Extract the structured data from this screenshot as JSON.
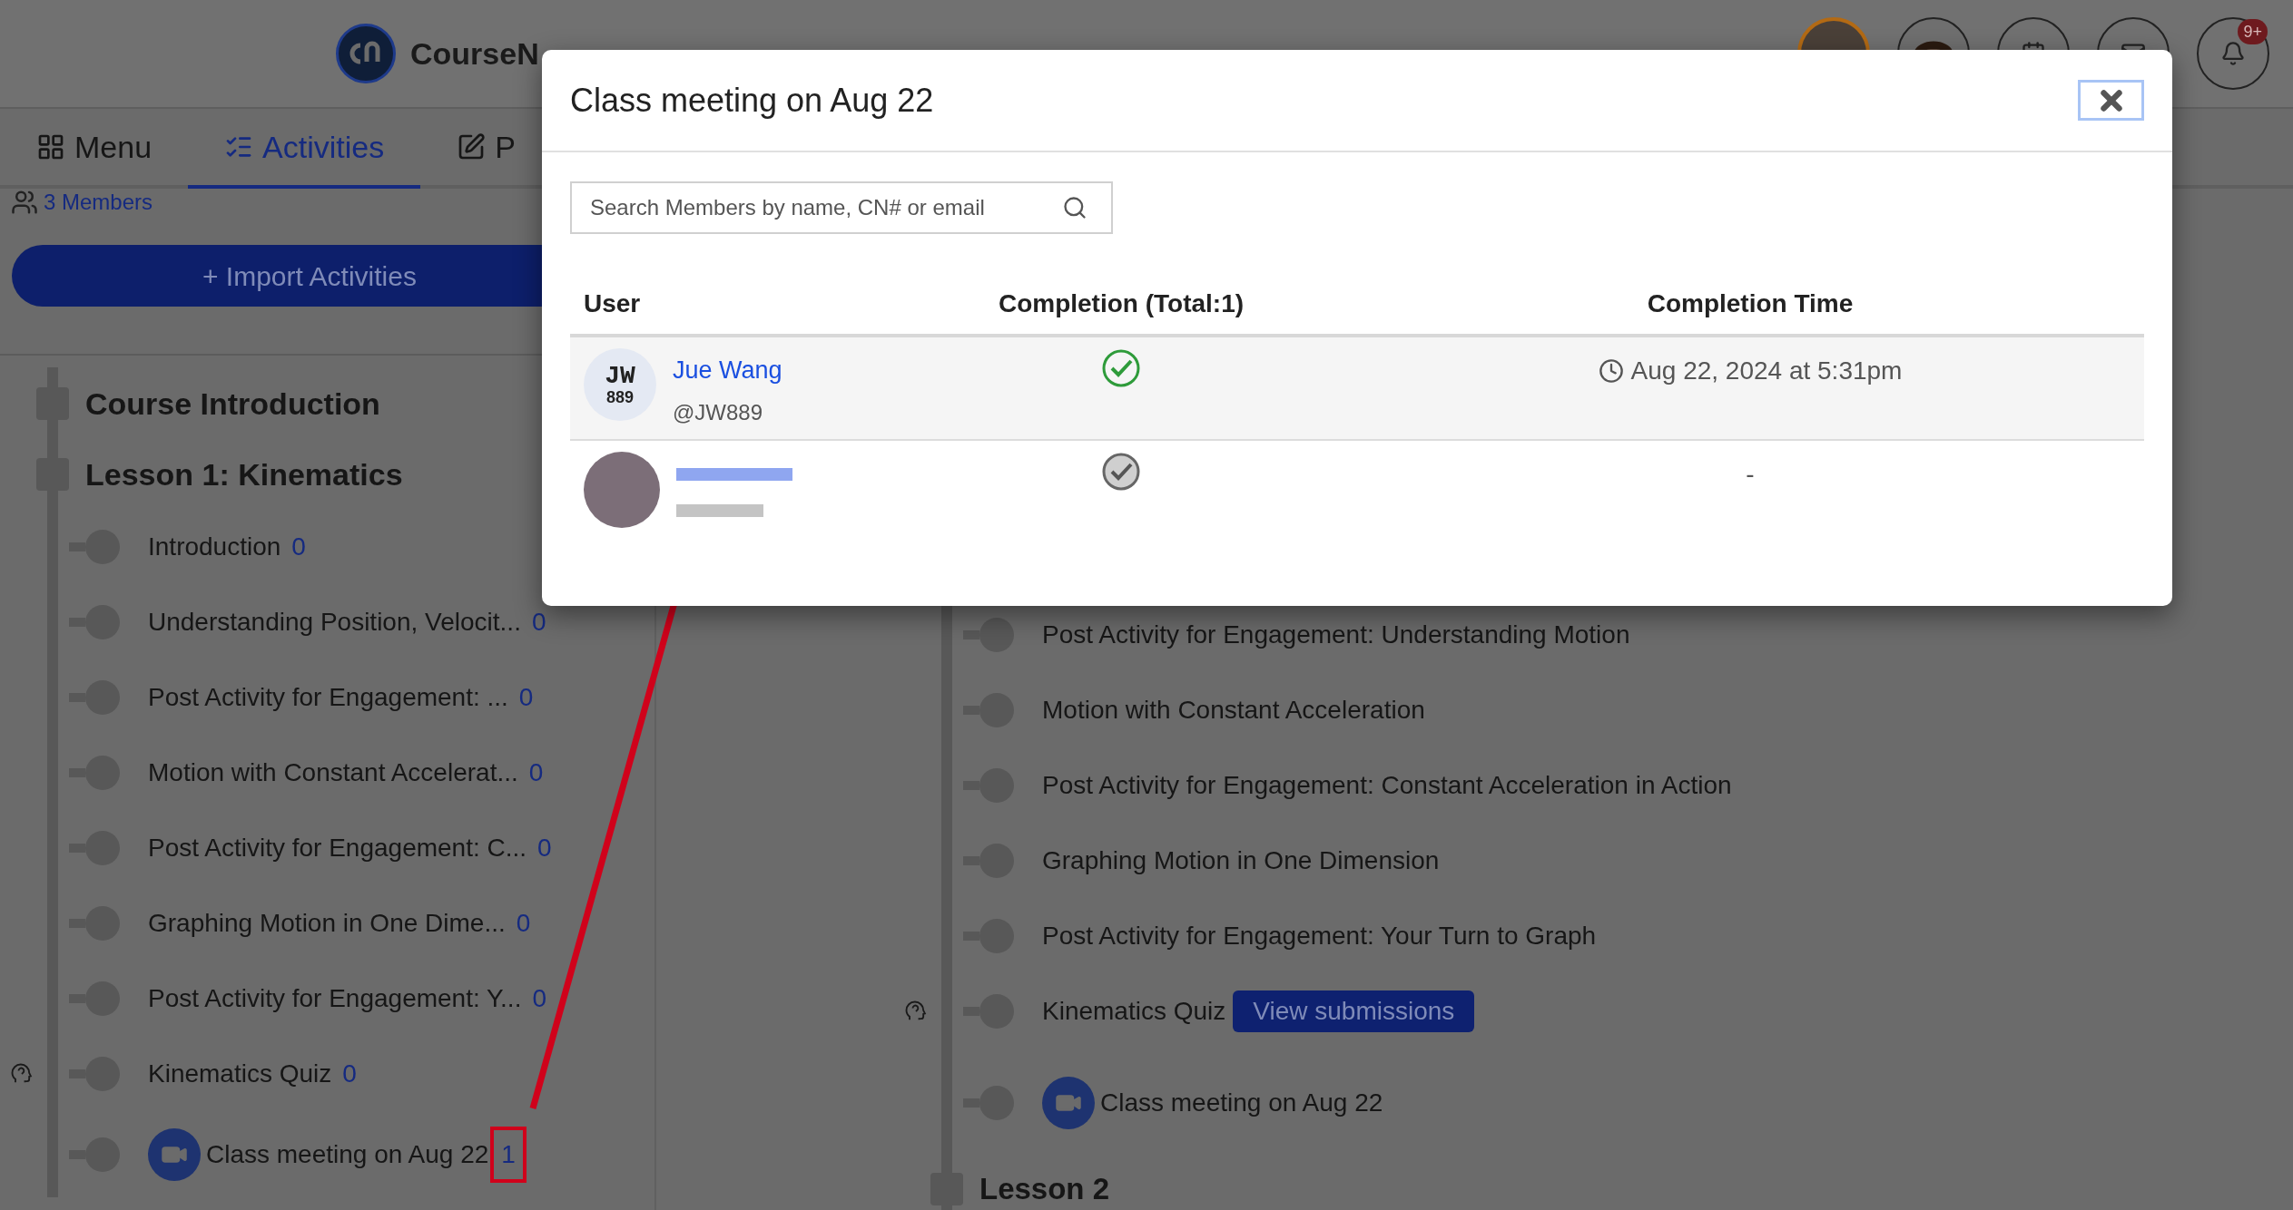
{
  "header": {
    "logo_text": "CourseN",
    "notification_badge": "9+"
  },
  "tabs": [
    {
      "label": "Menu",
      "selected": false
    },
    {
      "label": "Activities",
      "selected": true
    },
    {
      "label": "P",
      "selected": false
    }
  ],
  "members_link": "3 Members",
  "import_button": "+ Import Activities",
  "left_tree": [
    {
      "kind": "section",
      "title": "Course Introduction"
    },
    {
      "kind": "section",
      "title": "Lesson 1: Kinematics"
    },
    {
      "kind": "activity",
      "title": "Introduction",
      "count": "0"
    },
    {
      "kind": "activity",
      "title": "Understanding Position, Velocit...",
      "count": "0"
    },
    {
      "kind": "activity",
      "title": "Post Activity for Engagement: ...",
      "count": "0"
    },
    {
      "kind": "activity",
      "title": "Motion with Constant Accelerat...",
      "count": "0"
    },
    {
      "kind": "activity",
      "title": "Post Activity for Engagement: C...",
      "count": "0"
    },
    {
      "kind": "activity",
      "title": "Graphing Motion in One Dime...",
      "count": "0"
    },
    {
      "kind": "activity",
      "title": "Post Activity for Engagement: Y...",
      "count": "0"
    },
    {
      "kind": "quiz",
      "title": "Kinematics Quiz",
      "count": "0"
    },
    {
      "kind": "meeting",
      "title": "Class meeting on Aug 22",
      "count": "1",
      "highlighted": true
    }
  ],
  "right_tree": [
    {
      "kind": "activity",
      "title": "Post Activity for Engagement: Understanding Motion"
    },
    {
      "kind": "activity",
      "title": "Motion with Constant Acceleration"
    },
    {
      "kind": "activity",
      "title": "Post Activity for Engagement: Constant Acceleration in Action"
    },
    {
      "kind": "activity",
      "title": "Graphing Motion in One Dimension"
    },
    {
      "kind": "activity",
      "title": "Post Activity for Engagement: Your Turn to Graph"
    },
    {
      "kind": "quiz",
      "title": "Kinematics Quiz",
      "button": "View submissions"
    },
    {
      "kind": "meeting",
      "title": "Class meeting on Aug 22"
    },
    {
      "kind": "section",
      "title": "Lesson 2"
    }
  ],
  "modal": {
    "title": "Class meeting on Aug 22",
    "search": {
      "placeholder": "Search Members by name, CN# or email"
    },
    "columns": [
      "User",
      "Completion (Total:1)",
      "Completion Time"
    ],
    "rows": [
      {
        "kind": "member",
        "name": "Jue Wang",
        "handle": "@JW889",
        "initials": "JW",
        "number": "889",
        "completed": true,
        "time": "Aug 22, 2024 at 5:31pm"
      },
      {
        "kind": "redacted",
        "completed": false,
        "time": "-"
      }
    ]
  }
}
